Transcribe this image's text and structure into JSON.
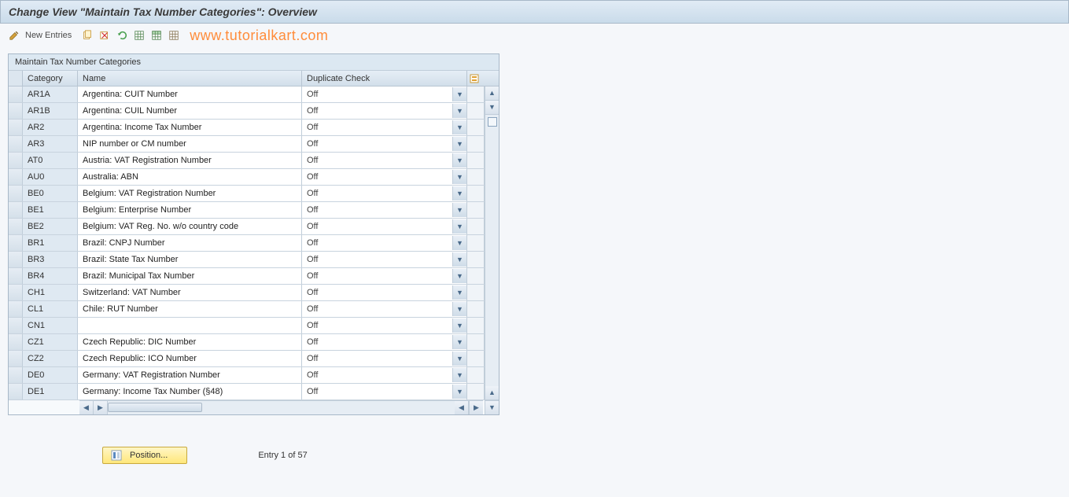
{
  "title": "Change View \"Maintain Tax Number Categories\": Overview",
  "toolbar": {
    "new_entries_label": "New Entries"
  },
  "watermark": "www.tutorialkart.com",
  "panel": {
    "title": "Maintain Tax Number Categories",
    "columns": {
      "category": "Category",
      "name": "Name",
      "duplicate_check": "Duplicate Check"
    },
    "rows": [
      {
        "category": "AR1A",
        "name": "Argentina: CUIT Number",
        "dup": "Off"
      },
      {
        "category": "AR1B",
        "name": "Argentina: CUIL Number",
        "dup": "Off"
      },
      {
        "category": "AR2",
        "name": "Argentina: Income Tax Number",
        "dup": "Off"
      },
      {
        "category": "AR3",
        "name": "NIP number or CM number",
        "dup": "Off"
      },
      {
        "category": "AT0",
        "name": "Austria: VAT Registration Number",
        "dup": "Off"
      },
      {
        "category": "AU0",
        "name": "Australia: ABN",
        "dup": "Off"
      },
      {
        "category": "BE0",
        "name": "Belgium: VAT Registration Number",
        "dup": "Off"
      },
      {
        "category": "BE1",
        "name": "Belgium: Enterprise Number",
        "dup": "Off"
      },
      {
        "category": "BE2",
        "name": "Belgium: VAT Reg. No. w/o country code",
        "dup": "Off"
      },
      {
        "category": "BR1",
        "name": "Brazil: CNPJ Number",
        "dup": "Off"
      },
      {
        "category": "BR3",
        "name": "Brazil: State Tax Number",
        "dup": "Off"
      },
      {
        "category": "BR4",
        "name": "Brazil: Municipal Tax Number",
        "dup": "Off"
      },
      {
        "category": "CH1",
        "name": "Switzerland: VAT Number",
        "dup": "Off"
      },
      {
        "category": "CL1",
        "name": "Chile: RUT Number",
        "dup": "Off"
      },
      {
        "category": "CN1",
        "name": "",
        "dup": "Off"
      },
      {
        "category": "CZ1",
        "name": "Czech Republic: DIC Number",
        "dup": "Off"
      },
      {
        "category": "CZ2",
        "name": "Czech Republic: ICO Number",
        "dup": "Off"
      },
      {
        "category": "DE0",
        "name": "Germany: VAT Registration Number",
        "dup": "Off"
      },
      {
        "category": "DE1",
        "name": "Germany: Income Tax Number (§48)",
        "dup": "Off"
      }
    ]
  },
  "footer": {
    "position_label": "Position...",
    "entry_text": "Entry 1 of 57"
  }
}
